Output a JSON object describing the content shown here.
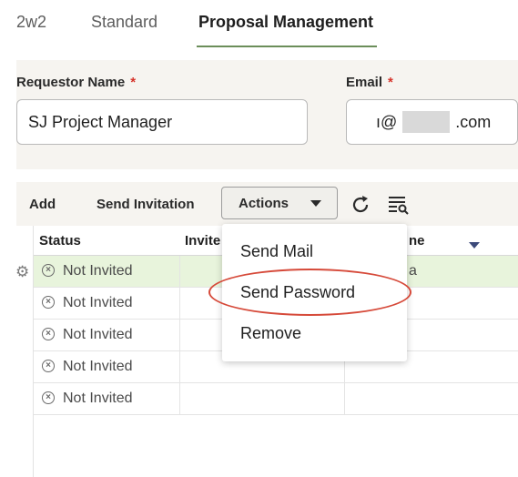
{
  "tabs": [
    {
      "label": "2w2",
      "active": false
    },
    {
      "label": "Standard",
      "active": false
    },
    {
      "label": "Proposal Management",
      "active": true
    }
  ],
  "form": {
    "requestor": {
      "label": "Requestor Name",
      "required_mark": "*",
      "value": "SJ Project Manager"
    },
    "email": {
      "label": "Email",
      "required_mark": "*",
      "value_prefix": "ı@",
      "value_suffix": ".com"
    }
  },
  "toolbar": {
    "add_label": "Add",
    "send_invitation_label": "Send Invitation",
    "actions_label": "Actions",
    "refresh_icon": "refresh-icon",
    "filter_icon": "filter-list-icon"
  },
  "table": {
    "columns": [
      "Status",
      "Invite",
      "ne"
    ],
    "rows": [
      {
        "status": "Not Invited",
        "selected": true,
        "extra": "a"
      },
      {
        "status": "Not Invited",
        "selected": false,
        "extra": ""
      },
      {
        "status": "Not Invited",
        "selected": false,
        "extra": ""
      },
      {
        "status": "Not Invited",
        "selected": false,
        "extra": ""
      },
      {
        "status": "Not Invited",
        "selected": false,
        "extra": ""
      }
    ]
  },
  "menu": {
    "items": [
      "Send Mail",
      "Send Password",
      "Remove"
    ],
    "highlighted": "Send Password"
  },
  "colors": {
    "accent_underline": "#6b8e5a",
    "required": "#d6332a",
    "selected_row": "#e8f4dc",
    "highlight_ellipse": "#d64a3a"
  }
}
